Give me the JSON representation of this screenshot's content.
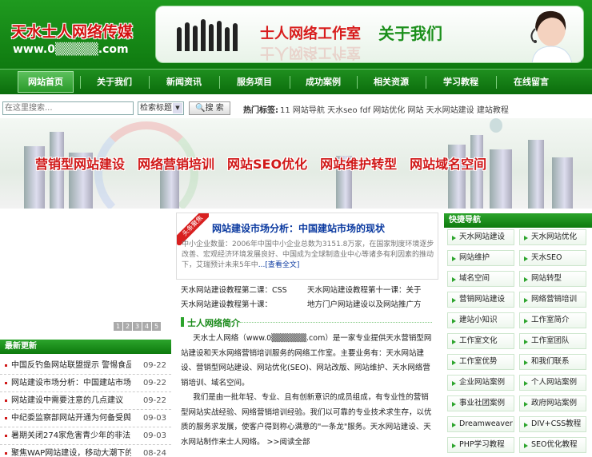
{
  "header": {
    "logo_text": "天水士人网络传媒",
    "logo_url": "www.0▒▒▒▒▒.com",
    "banner_title_red": "士人网络工作室",
    "banner_title_green": "关于我们"
  },
  "nav": {
    "items": [
      "网站首页",
      "关于我们",
      "新闻资讯",
      "服务项目",
      "成功案例",
      "相关资源",
      "学习教程",
      "在线留言"
    ]
  },
  "search": {
    "placeholder": "在这里搜索...",
    "select_value": "检索标题",
    "button_label": "搜 索",
    "hot_label": "热门标签:",
    "hot_tags": "11 网站导航 天水seo fdf 网站优化 网站 天水网站建设 建站教程"
  },
  "banner": {
    "words": [
      "营销型网站建设",
      "网络营销培训",
      "网站SEO优化",
      "网站维护转型",
      "网站域名空间"
    ]
  },
  "left": {
    "pager": [
      "1",
      "2",
      "3",
      "4",
      "5"
    ],
    "latest_title": "最新更新",
    "news": [
      {
        "title": "中国反钓鱼网站联盟提示 警惕食品",
        "date": "09-22"
      },
      {
        "title": "网站建设市场分析：中国建站市场的",
        "date": "09-22"
      },
      {
        "title": "网站建设中需要注意的几点建议",
        "date": "09-22"
      },
      {
        "title": "中纪委监察部网站开通为何备受舆论",
        "date": "09-03"
      },
      {
        "title": "暑期关闭274家危害青少年的非法网",
        "date": "09-03"
      },
      {
        "title": "聚焦WAP网站建设，移动大潮下的",
        "date": "08-24"
      }
    ]
  },
  "middle": {
    "ribbon": "头条聚焦",
    "headline": "网站建设市场分析：中国建站市场的现状",
    "summary": "中小企业数量：2006年中国中小企业总数为3151.8万家，在国家制度环境逐步改善、宏观经济环境发展良好、中国成为全球制造业中心等诸多有利因素的推动下，艾瑞预计未来5年中",
    "summary_more": "...[查看全文]",
    "links": [
      "天水网站建设教程第二课：CSS",
      "天水网站建设教程第十一课：关于",
      "天水网站建设教程第十课：",
      "地方门户网站建设以及网站推广方"
    ],
    "intro_title": "士人网络简介",
    "intro_p1": "天水士人网络（www.0▒▒▒▒▒▒.com）是一家专业提供天水营销型网站建设和天水网络营销培训服务的网络工作室。主要业务有：天水网站建设、营销型网站建设、网站优化(SEO)、网站改版、网站维护、天水网络营销培训、域名空间。",
    "intro_p2": "我们是由一批年轻、专业、且有创新意识的成员组成，有专业性的营销型网站实战经验、网络营销培训经验。我们以可靠的专业技术求生存，以优质的服务求发展，使客户得到称心满意的\"一条龙\"服务。天水网站建设、天水网站制作来士人网络。",
    "read_more": ">>阅读全部"
  },
  "right": {
    "title": "快捷导航",
    "items": [
      "天水网站建设",
      "天水网站优化",
      "网站维护",
      "天水SEO",
      "域名空间",
      "网站转型",
      "营销网站建设",
      "网络营销培训",
      "建站小知识",
      "工作室简介",
      "工作室文化",
      "工作室团队",
      "工作室优势",
      "和我们联系",
      "企业网站案例",
      "个人网站案例",
      "事业社团案例",
      "政府网站案例",
      "Dreamweaver",
      "DIV+CSS教程",
      "PHP学习教程",
      "SEO优化教程"
    ]
  },
  "colors": {
    "brand_green": "#0f7a10",
    "accent_red": "#d01818",
    "link_blue": "#0b3aa0"
  }
}
